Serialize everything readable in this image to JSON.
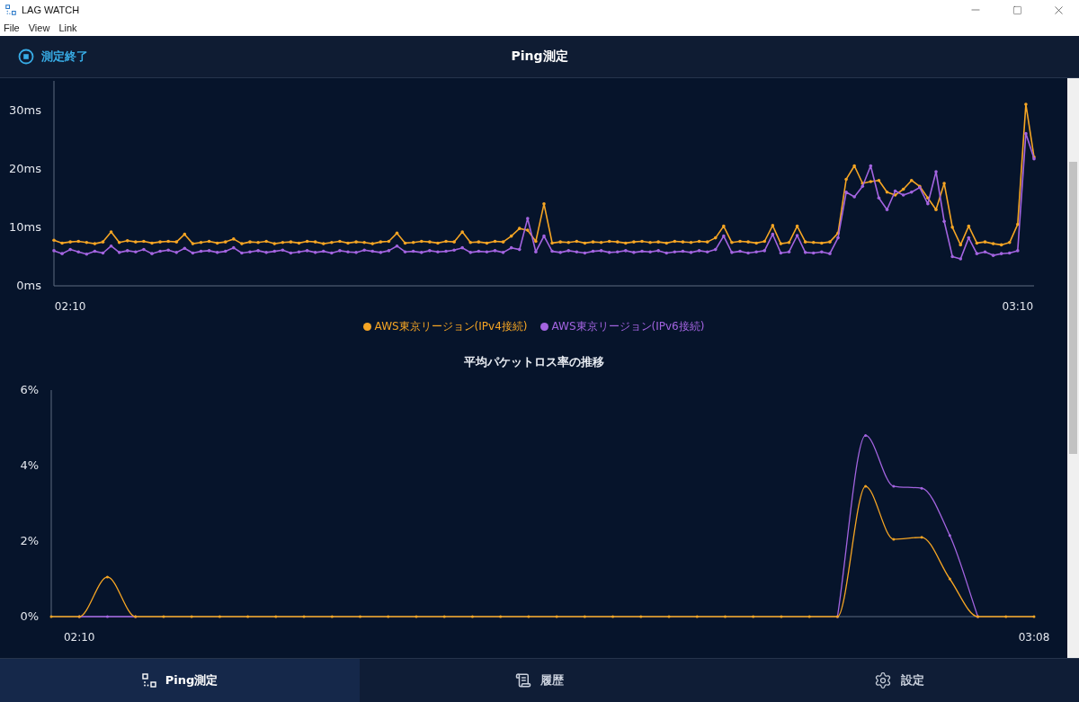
{
  "window": {
    "title": "LAG WATCH"
  },
  "menu": [
    "File",
    "View",
    "Link"
  ],
  "header": {
    "stop_button": "測定終了",
    "title": "Ping測定"
  },
  "ping_chart": {
    "chart_data": {
      "type": "line",
      "ylim": [
        0,
        35
      ],
      "yticks": [
        {
          "value": 0,
          "label": "0ms"
        },
        {
          "value": 10,
          "label": "10ms"
        },
        {
          "value": 20,
          "label": "20ms"
        },
        {
          "value": 30,
          "label": "30ms"
        }
      ],
      "categories": [
        null,
        null,
        "02:10",
        null,
        null,
        null,
        null,
        null,
        null,
        null,
        null,
        null,
        null,
        null,
        null,
        null,
        null,
        null,
        null,
        null,
        null,
        null,
        null,
        null,
        null,
        null,
        null,
        null,
        null,
        null,
        null,
        null,
        null,
        null,
        null,
        null,
        null,
        null,
        null,
        null,
        null,
        null,
        null,
        null,
        null,
        null,
        null,
        null,
        null,
        null,
        null,
        null,
        null,
        null,
        null,
        null,
        null,
        null,
        null,
        null,
        null,
        null,
        null,
        null,
        null,
        null,
        null,
        null,
        null,
        null,
        null,
        null,
        null,
        null,
        null,
        null,
        null,
        null,
        null,
        null,
        null,
        null,
        null,
        null,
        null,
        null,
        null,
        null,
        null,
        null,
        null,
        null,
        null,
        null,
        null,
        null,
        null,
        null,
        null,
        null,
        null,
        null,
        null,
        null,
        null,
        null,
        null,
        null,
        null,
        null,
        null,
        null,
        null,
        null,
        null,
        null,
        null,
        null,
        "03:10",
        null,
        null
      ],
      "legend": "bottom",
      "series": [
        {
          "name": "AWS東京リージョン(IPv4接続)",
          "color": "#f5a524",
          "values": [
            7.8,
            7.3,
            7.5,
            7.6,
            7.4,
            7.2,
            7.5,
            9.2,
            7.4,
            7.7,
            7.5,
            7.6,
            7.3,
            7.5,
            7.6,
            7.5,
            8.8,
            7.2,
            7.4,
            7.6,
            7.3,
            7.5,
            8.0,
            7.2,
            7.5,
            7.4,
            7.6,
            7.2,
            7.4,
            7.5,
            7.3,
            7.6,
            7.5,
            7.2,
            7.4,
            7.6,
            7.3,
            7.5,
            7.4,
            7.2,
            7.5,
            7.6,
            9.0,
            7.3,
            7.4,
            7.6,
            7.5,
            7.3,
            7.6,
            7.5,
            9.2,
            7.4,
            7.5,
            7.3,
            7.6,
            7.5,
            8.5,
            9.8,
            9.5,
            7.6,
            14.0,
            7.3,
            7.5,
            7.4,
            7.6,
            7.3,
            7.5,
            7.4,
            7.6,
            7.5,
            7.3,
            7.5,
            7.6,
            7.4,
            7.5,
            7.3,
            7.6,
            7.5,
            7.4,
            7.6,
            7.5,
            8.2,
            10.2,
            7.4,
            7.6,
            7.5,
            7.3,
            7.6,
            10.3,
            7.2,
            7.4,
            10.2,
            7.5,
            7.4,
            7.3,
            7.5,
            9.0,
            18.2,
            20.5,
            17.5,
            17.8,
            18.0,
            16.0,
            15.5,
            16.5,
            18.0,
            17.0,
            15.0,
            13.0,
            17.5,
            10.0,
            7.0,
            10.2,
            7.3,
            7.5,
            7.2,
            7.0,
            7.4,
            10.5,
            31.0,
            22.0
          ]
        },
        {
          "name": "AWS東京リージョン(IPv6接続)",
          "color": "#a364e0",
          "values": [
            6.0,
            5.5,
            6.2,
            5.8,
            5.4,
            5.9,
            5.6,
            6.8,
            5.7,
            6.0,
            5.8,
            6.2,
            5.5,
            5.9,
            6.1,
            5.7,
            6.4,
            5.6,
            5.9,
            6.0,
            5.7,
            5.9,
            6.5,
            5.6,
            5.8,
            6.0,
            5.7,
            5.9,
            6.1,
            5.6,
            5.8,
            6.0,
            5.7,
            5.9,
            5.6,
            6.0,
            5.8,
            5.7,
            6.1,
            5.9,
            5.7,
            6.0,
            6.8,
            5.8,
            5.9,
            5.7,
            6.0,
            5.8,
            5.9,
            6.1,
            6.5,
            5.7,
            5.9,
            5.8,
            6.0,
            5.7,
            6.5,
            6.2,
            11.5,
            5.8,
            8.5,
            5.9,
            5.7,
            6.0,
            5.8,
            5.6,
            5.9,
            6.0,
            5.7,
            5.8,
            6.0,
            5.7,
            5.9,
            5.8,
            6.0,
            5.6,
            5.8,
            5.9,
            5.7,
            6.0,
            5.8,
            6.2,
            8.5,
            5.7,
            5.9,
            5.6,
            5.8,
            6.0,
            8.8,
            5.6,
            5.8,
            8.6,
            5.7,
            5.6,
            5.8,
            5.5,
            8.2,
            16.0,
            15.2,
            17.0,
            20.5,
            15.0,
            13.0,
            16.2,
            15.5,
            16.0,
            16.8,
            14.0,
            19.5,
            11.0,
            5.0,
            4.6,
            8.2,
            5.5,
            5.8,
            5.2,
            5.5,
            5.6,
            6.0,
            26.0,
            21.7
          ]
        }
      ]
    }
  },
  "loss_chart": {
    "chart_data": {
      "type": "line",
      "title": "平均パケットロス率の推移",
      "ylim": [
        0,
        6
      ],
      "yticks": [
        {
          "value": 0,
          "label": "0%"
        },
        {
          "value": 2,
          "label": "2%"
        },
        {
          "value": 4,
          "label": "4%"
        },
        {
          "value": 6,
          "label": "6%"
        }
      ],
      "categories": [
        null,
        "02:10",
        null,
        null,
        null,
        null,
        null,
        null,
        null,
        null,
        null,
        null,
        null,
        null,
        null,
        null,
        null,
        null,
        null,
        null,
        null,
        null,
        null,
        null,
        null,
        null,
        null,
        null,
        null,
        null,
        null,
        null,
        null,
        null,
        null,
        "03:08"
      ],
      "series": [
        {
          "color": "#a364e0",
          "values": [
            null,
            0,
            0,
            0,
            null,
            null,
            null,
            null,
            null,
            null,
            null,
            null,
            null,
            null,
            null,
            null,
            null,
            null,
            null,
            null,
            null,
            null,
            null,
            null,
            null,
            null,
            null,
            null,
            0,
            4.8,
            3.45,
            3.4,
            2.15,
            0,
            null,
            null
          ]
        },
        {
          "color": "#f5a524",
          "values": [
            0,
            0,
            1.05,
            0,
            0,
            0,
            0,
            0,
            0,
            0,
            0,
            0,
            0,
            0,
            0,
            0,
            0,
            0,
            0,
            0,
            0,
            0,
            0,
            0,
            0,
            0,
            0,
            0,
            0,
            3.45,
            2.05,
            2.1,
            1.0,
            0,
            0,
            0
          ]
        }
      ]
    }
  },
  "nav_tabs": [
    {
      "kind": "ping",
      "label": "Ping測定",
      "selected": true
    },
    {
      "kind": "history",
      "label": "履歴",
      "selected": false
    },
    {
      "kind": "settings",
      "label": "設定",
      "selected": false
    }
  ]
}
